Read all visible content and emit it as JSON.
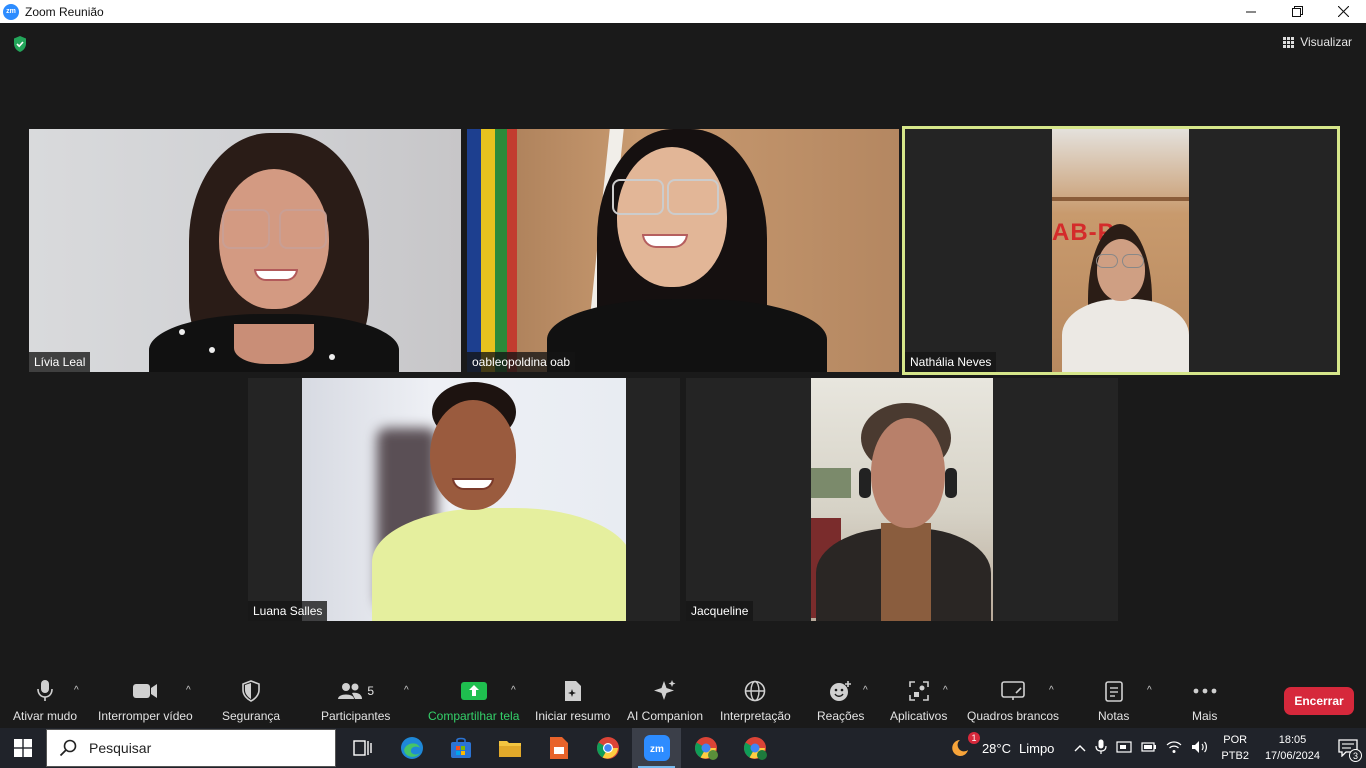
{
  "window": {
    "title": "Zoom Reunião",
    "logo_text": "zm"
  },
  "meeting": {
    "view_label": "Visualizar",
    "participants": [
      {
        "name": "Lívia Leal",
        "active": false
      },
      {
        "name": "oableopoldina oab",
        "active": false
      },
      {
        "name": "Nathália Neves",
        "active": true
      },
      {
        "name": "Luana Salles",
        "active": false
      },
      {
        "name": "Jacqueline",
        "active": false
      }
    ],
    "background_text": "AB-P"
  },
  "toolbar": {
    "mute": "Ativar mudo",
    "video": "Interromper vídeo",
    "security": "Segurança",
    "participants": "Participantes",
    "participants_count": "5",
    "share": "Compartilhar tela",
    "summary": "Iniciar resumo",
    "companion": "AI Companion",
    "interpretation": "Interpretação",
    "reactions": "Reações",
    "apps": "Aplicativos",
    "whiteboards": "Quadros brancos",
    "notes": "Notas",
    "more": "Mais",
    "end": "Encerrar"
  },
  "taskbar": {
    "search_placeholder": "Pesquisar",
    "weather_temp": "28°C",
    "weather_cond": "Limpo",
    "weather_badge": "1",
    "lang_top": "POR",
    "lang_bottom": "PTB2",
    "time": "18:05",
    "date": "17/06/2024",
    "notif_count": "3"
  },
  "colors": {
    "accent": "#2d8cff",
    "active_speaker": "#d6e68a",
    "share_green": "#1fbf4f",
    "end_red": "#d6283b"
  }
}
